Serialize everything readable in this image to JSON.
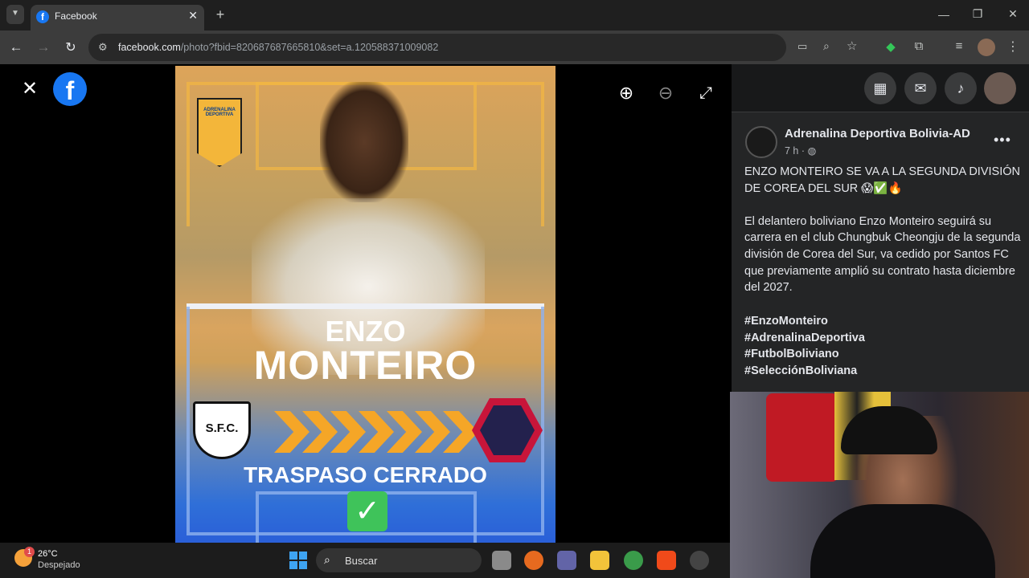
{
  "browser": {
    "tab_title": "Facebook",
    "url_host": "facebook.com",
    "url_path": "/photo?fbid=820687687665810&set=a.120588371009082"
  },
  "photo": {
    "logo_text": "ADRENALINA DEPORTIVA",
    "first_name": "ENZO",
    "last_name": "MONTEIRO",
    "from_club": "S.F.C.",
    "transfer_label": "TRASPASO CERRADO"
  },
  "post": {
    "page_name": "Adrenalina Deportiva Bolivia-AD",
    "time": "7 h",
    "headline": "ENZO MONTEIRO SE VA A LA SEGUNDA DIVISIÓN DE COREA DEL SUR 😱✅🔥",
    "body": "El delantero boliviano Enzo Monteiro seguirá su carrera en el club Chungbuk Cheongju de la segunda división de Corea del Sur, va cedido por Santos FC que previamente amplió su contrato hasta diciembre del 2027.",
    "hashtags": [
      "#EnzoMonteiro",
      "#AdrenalinaDeportiva",
      "#FutbolBoliviano",
      "#SelecciónBoliviana"
    ]
  },
  "taskbar": {
    "weather_badge": "1",
    "temperature": "26°C",
    "condition": "Despejado",
    "search_placeholder": "Buscar"
  },
  "colors": {
    "fb_blue": "#1877f2",
    "panel_bg": "#242526",
    "accent_gold": "#f2b643"
  }
}
